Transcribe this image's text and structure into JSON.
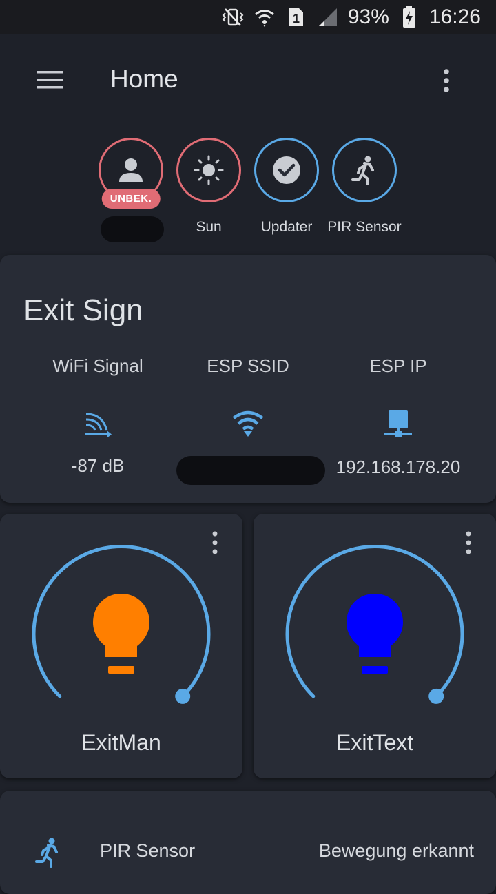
{
  "status_bar": {
    "battery": "93%",
    "time": "16:26",
    "sim_slot": "1",
    "icons": [
      "vibrate-icon",
      "wifi-icon",
      "sim-icon",
      "signal-icon",
      "battery-charging-icon"
    ]
  },
  "app_bar": {
    "title": "Home"
  },
  "badges": [
    {
      "name": "",
      "tag": "UNBEK.",
      "icon": "person-icon",
      "border": "#e06c75"
    },
    {
      "name": "Sun",
      "icon": "sun-icon",
      "border": "#e06c75"
    },
    {
      "name": "Updater",
      "icon": "check-circle-icon",
      "border": "#5aa9e6"
    },
    {
      "name": "PIR Sensor",
      "icon": "walk-icon",
      "border": "#5aa9e6"
    }
  ],
  "exit_sign": {
    "title": "Exit Sign",
    "columns": [
      {
        "header": "WiFi Signal",
        "icon": "wifi-strength-icon",
        "value": "-87 dB"
      },
      {
        "header": "ESP SSID",
        "icon": "wifi-icon",
        "value": ""
      },
      {
        "header": "ESP IP",
        "icon": "network-icon",
        "value": "192.168.178.20"
      }
    ]
  },
  "lights": [
    {
      "name": "ExitMan",
      "color": "#ff7f00",
      "brightness": 1.0
    },
    {
      "name": "ExitText",
      "color": "#0000ff",
      "brightness": 1.0
    }
  ],
  "sensor_row": {
    "name": "PIR Sensor",
    "state": "Bewegung erkannt",
    "icon": "walk-icon"
  },
  "colors": {
    "accent": "#5aa9e6",
    "alert": "#e06c75",
    "background": "#1e2129",
    "card": "#282c36"
  }
}
